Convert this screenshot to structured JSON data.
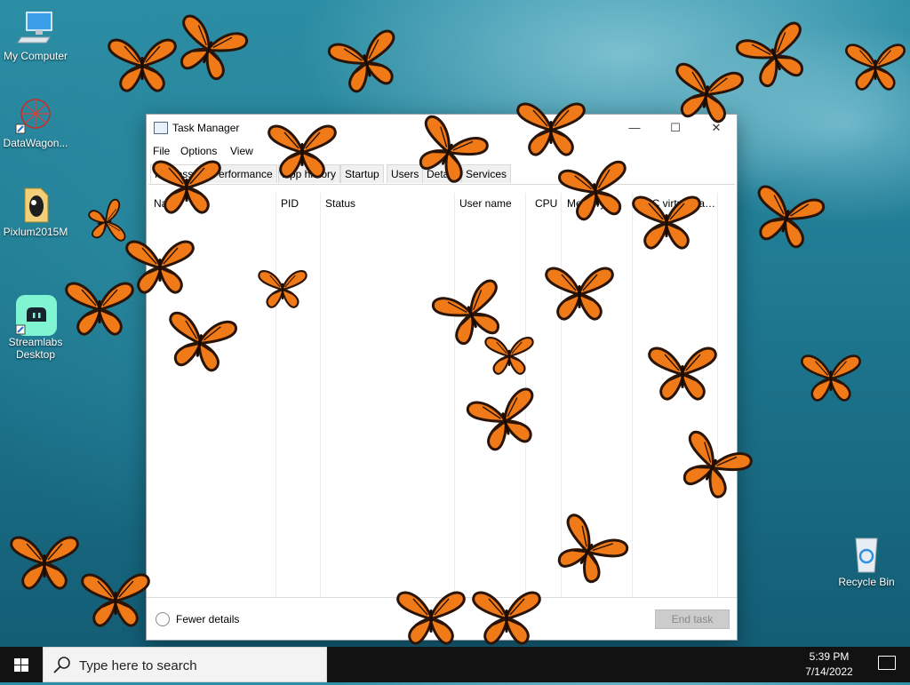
{
  "desktop": {
    "icons": [
      {
        "label": "My Computer"
      },
      {
        "label": "DataWagon..."
      },
      {
        "label": "Pixlum2015M"
      },
      {
        "label": "Streamlabs\nDesktop"
      },
      {
        "label": "Recycle Bin"
      }
    ]
  },
  "window": {
    "title": "Task Manager",
    "menu": [
      "File",
      "Options",
      "View"
    ],
    "tabs": [
      "Processes",
      "Performance",
      "App history",
      "Startup",
      "Users",
      "Details",
      "Services"
    ],
    "columns": [
      "Name",
      "PID",
      "Status",
      "User name",
      "CPU",
      "Memory",
      "UAC virtualization"
    ],
    "footer": {
      "fewer_details": "Fewer details",
      "end_task": "End task"
    }
  },
  "taskbar": {
    "search_placeholder": "Type here to search",
    "time": "5:39 PM",
    "date": "7/14/2022"
  },
  "colors": {
    "butterfly_orange": "#f07a18",
    "butterfly_dark": "#2a1408"
  }
}
